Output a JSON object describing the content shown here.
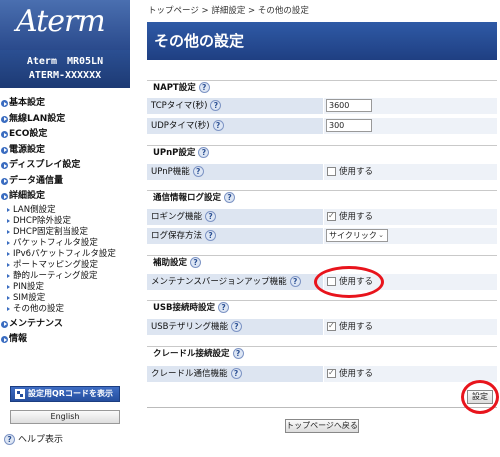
{
  "brand": {
    "logo": "Aterm",
    "model_line1": "Aterm　MR05LN",
    "model_line2": "ATERM-XXXXXX"
  },
  "nav": {
    "main1": [
      "基本設定",
      "無線LAN設定",
      "ECO設定",
      "電源設定",
      "ディスプレイ設定",
      "データ通信量",
      "詳細設定"
    ],
    "sub": [
      "LAN側設定",
      "DHCP除外設定",
      "DHCP固定割当設定",
      "パケットフィルタ設定",
      "IPv6パケットフィルタ設定",
      "ポートマッピング設定",
      "静的ルーティング設定",
      "PIN設定",
      "SIM設定",
      "その他の設定"
    ],
    "main2": [
      "メンテナンス",
      "情報"
    ]
  },
  "qr_button": "設定用QRコードを表示",
  "language_button": "English",
  "help_link": "ヘルプ表示",
  "breadcrumb": "トップページ > 詳細設定 > その他の設定",
  "page_title": "その他の設定",
  "help_icon": "?",
  "sections": {
    "napt": {
      "title": "NAPT設定",
      "tcp_label": "TCPタイマ(秒)",
      "tcp_value": "3600",
      "udp_label": "UDPタイマ(秒)",
      "udp_value": "300"
    },
    "upnp": {
      "title": "UPnP設定",
      "label": "UPnP機能",
      "check_label": "使用する",
      "checked": false
    },
    "log": {
      "title": "通信情報ログ設定",
      "logging_label": "ロギング機能",
      "logging_check": "使用する",
      "logging_checked": true,
      "method_label": "ログ保存方法",
      "method_value": "サイクリック"
    },
    "aux": {
      "title": "補助設定",
      "label": "メンテナンスバージョンアップ機能",
      "check_label": "使用する",
      "checked": false
    },
    "usb": {
      "title": "USB接続時設定",
      "label": "USBテザリング機能",
      "check_label": "使用する",
      "checked": true
    },
    "cradle": {
      "title": "クレードル接続設定",
      "label": "クレードル通信機能",
      "check_label": "使用する",
      "checked": true
    }
  },
  "set_button": "設定",
  "top_button": "トップページへ戻る",
  "colors": {
    "header": "#2f5aa6",
    "label_bg": "#dde5f1",
    "highlight": "#e8141c"
  }
}
